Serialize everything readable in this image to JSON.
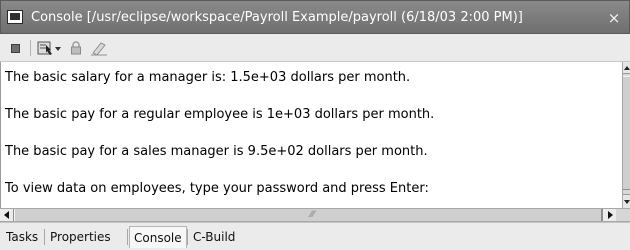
{
  "window": {
    "title": "Console [/usr/eclipse/workspace/Payroll Example/payroll (6/18/03 2:00 PM)]",
    "close_label": "×"
  },
  "toolbar": {
    "buttons": [
      {
        "name": "terminate",
        "icon": "stop-icon"
      },
      {
        "name": "display-selected-console",
        "icon": "console-run-icon"
      },
      {
        "name": "pin-console",
        "icon": "lock-icon"
      },
      {
        "name": "clear-console",
        "icon": "eraser-icon"
      }
    ]
  },
  "console": {
    "lines": [
      "The basic salary for a manager is: 1.5e+03 dollars per month.",
      "The basic pay for a regular employee is 1e+03 dollars per month.",
      "The basic pay for a sales manager is 9.5e+02 dollars per month.",
      "To view data on employees, type your password and press Enter:"
    ]
  },
  "tabs": {
    "items": [
      {
        "label": "Tasks",
        "active": false
      },
      {
        "label": "Properties",
        "active": false
      },
      {
        "label": "Console",
        "active": true
      },
      {
        "label": "C-Build",
        "active": false
      }
    ]
  },
  "colors": {
    "title_bar": "#7a7a7a",
    "panel": "#ebebeb",
    "console_background": "#ffffff",
    "text": "#000000"
  }
}
